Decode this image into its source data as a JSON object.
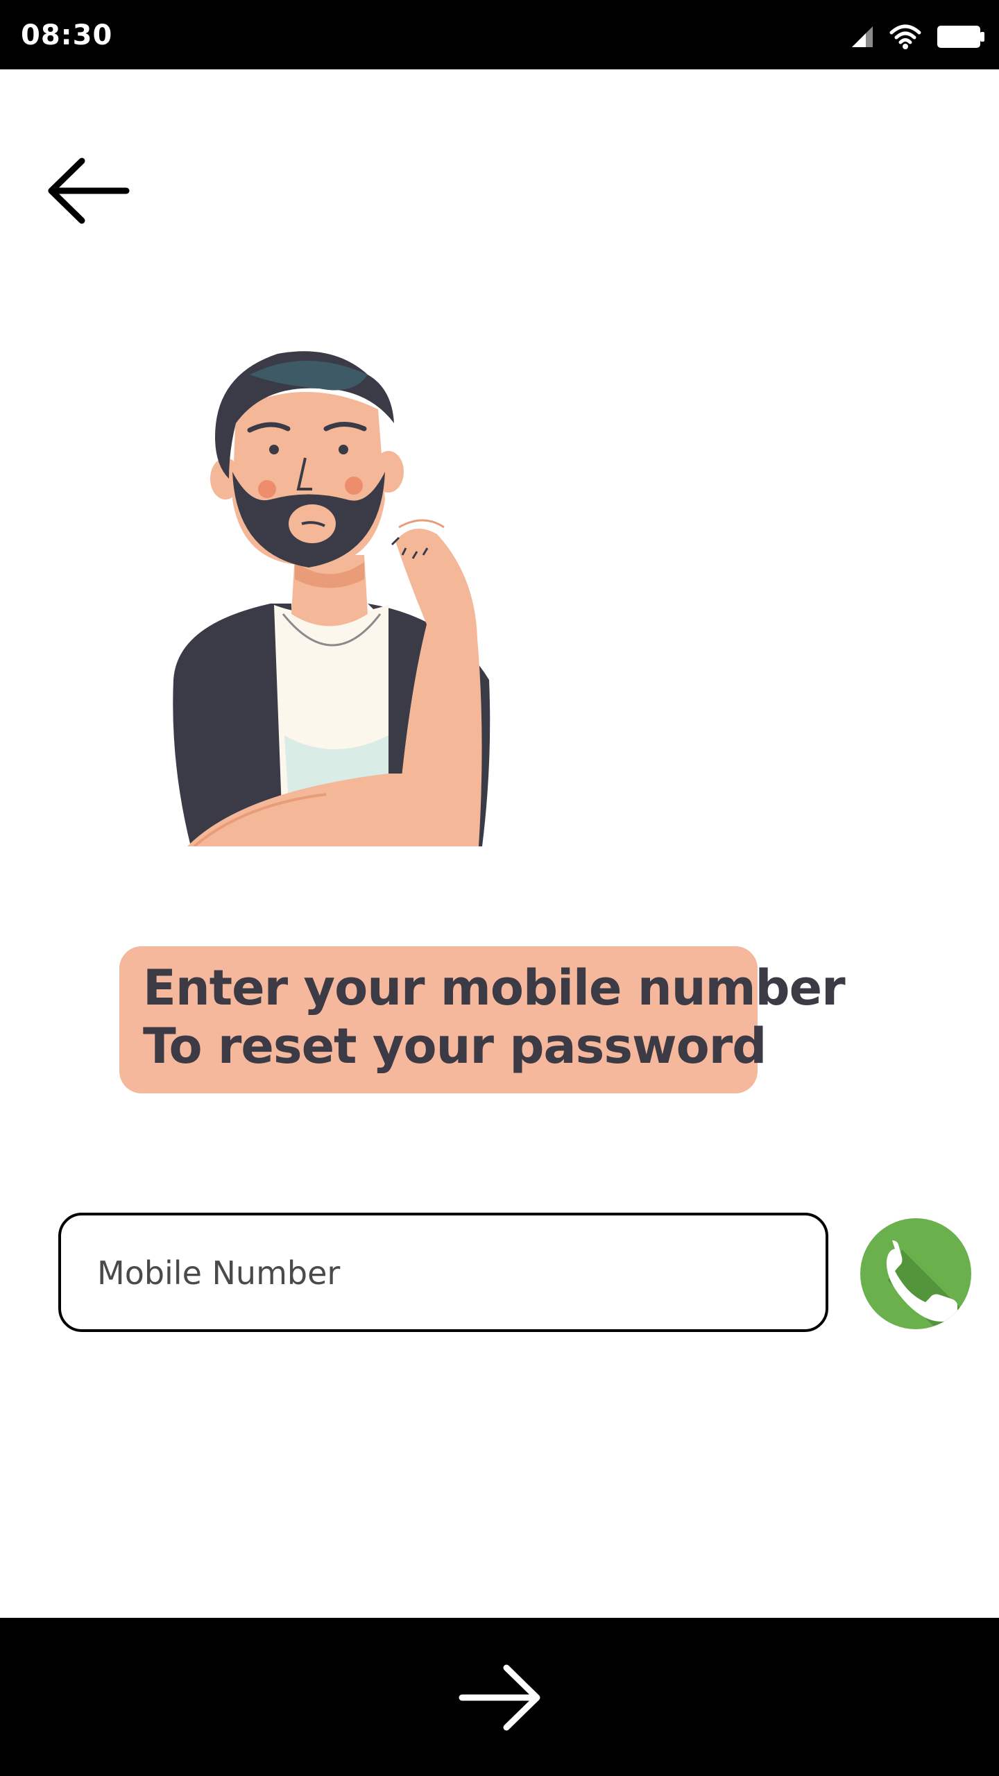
{
  "status_bar": {
    "time": "08:30",
    "icons": [
      "cell-signal-icon",
      "wifi-icon",
      "battery-icon"
    ]
  },
  "navigation": {
    "back_icon": "arrow-left-icon",
    "next_icon": "arrow-right-icon"
  },
  "illustration": {
    "subject": "thinking-man-illustration"
  },
  "info_bubble": {
    "line1": "Enter your mobile number",
    "line2": "To reset your password"
  },
  "mobile_input": {
    "value": "",
    "placeholder": "Mobile Number"
  },
  "phone_button": {
    "icon": "phone-icon"
  },
  "colors": {
    "bubble_bg": "#f6b89c",
    "bubble_text": "#3b3a45",
    "phone_green": "#6ab04c",
    "bar_black": "#000000"
  }
}
